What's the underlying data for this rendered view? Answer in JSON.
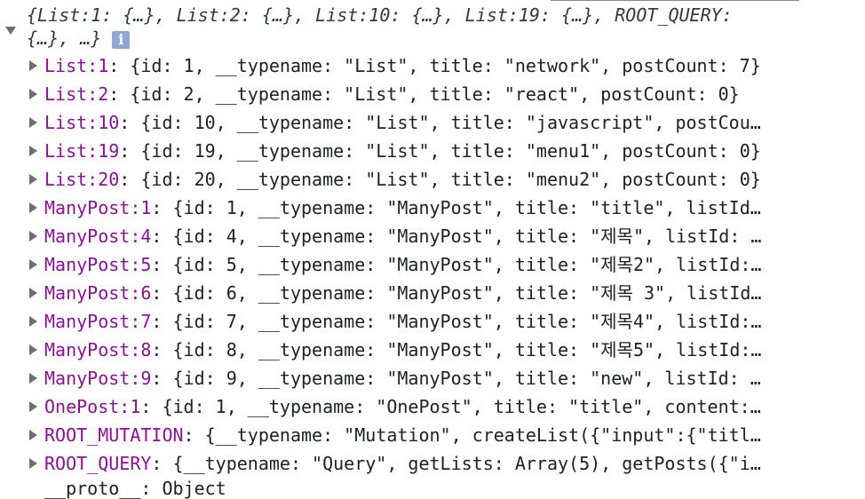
{
  "summary": {
    "line1": "{List:1: {…}, List:2: {…}, List:10: {…}, List:19: {…}, ROOT_QUERY:",
    "line2": "{…}, …}",
    "info_glyph": "i"
  },
  "rows": [
    {
      "key": "List:1",
      "value": "{id: 1, __typename: \"List\", title: \"network\", postCount: 7}"
    },
    {
      "key": "List:2",
      "value": "{id: 2, __typename: \"List\", title: \"react\", postCount: 0}"
    },
    {
      "key": "List:10",
      "value": "{id: 10, __typename: \"List\", title: \"javascript\", postCou…"
    },
    {
      "key": "List:19",
      "value": "{id: 19, __typename: \"List\", title: \"menu1\", postCount: 0}"
    },
    {
      "key": "List:20",
      "value": "{id: 20, __typename: \"List\", title: \"menu2\", postCount: 0}"
    },
    {
      "key": "ManyPost:1",
      "value": "{id: 1, __typename: \"ManyPost\", title: \"title\", listId…"
    },
    {
      "key": "ManyPost:4",
      "value": "{id: 4, __typename: \"ManyPost\", title: \"제목\", listId: …"
    },
    {
      "key": "ManyPost:5",
      "value": "{id: 5, __typename: \"ManyPost\", title: \"제목2\", listId:…"
    },
    {
      "key": "ManyPost:6",
      "value": "{id: 6, __typename: \"ManyPost\", title: \"제목 3\", listId…"
    },
    {
      "key": "ManyPost:7",
      "value": "{id: 7, __typename: \"ManyPost\", title: \"제목4\", listId:…"
    },
    {
      "key": "ManyPost:8",
      "value": "{id: 8, __typename: \"ManyPost\", title: \"제목5\", listId:…"
    },
    {
      "key": "ManyPost:9",
      "value": "{id: 9, __typename: \"ManyPost\", title: \"new\", listId: …"
    },
    {
      "key": "OnePost:1",
      "value": "{id: 1, __typename: \"OnePost\", title: \"title\", content:…"
    },
    {
      "key": "ROOT_MUTATION",
      "value": "{__typename: \"Mutation\", createList({\"input\":{\"titl…"
    },
    {
      "key": "ROOT_QUERY",
      "value": "{__typename: \"Query\", getLists: Array(5), getPosts({\"i…"
    }
  ],
  "bottom_partial": "__proto__: Object"
}
